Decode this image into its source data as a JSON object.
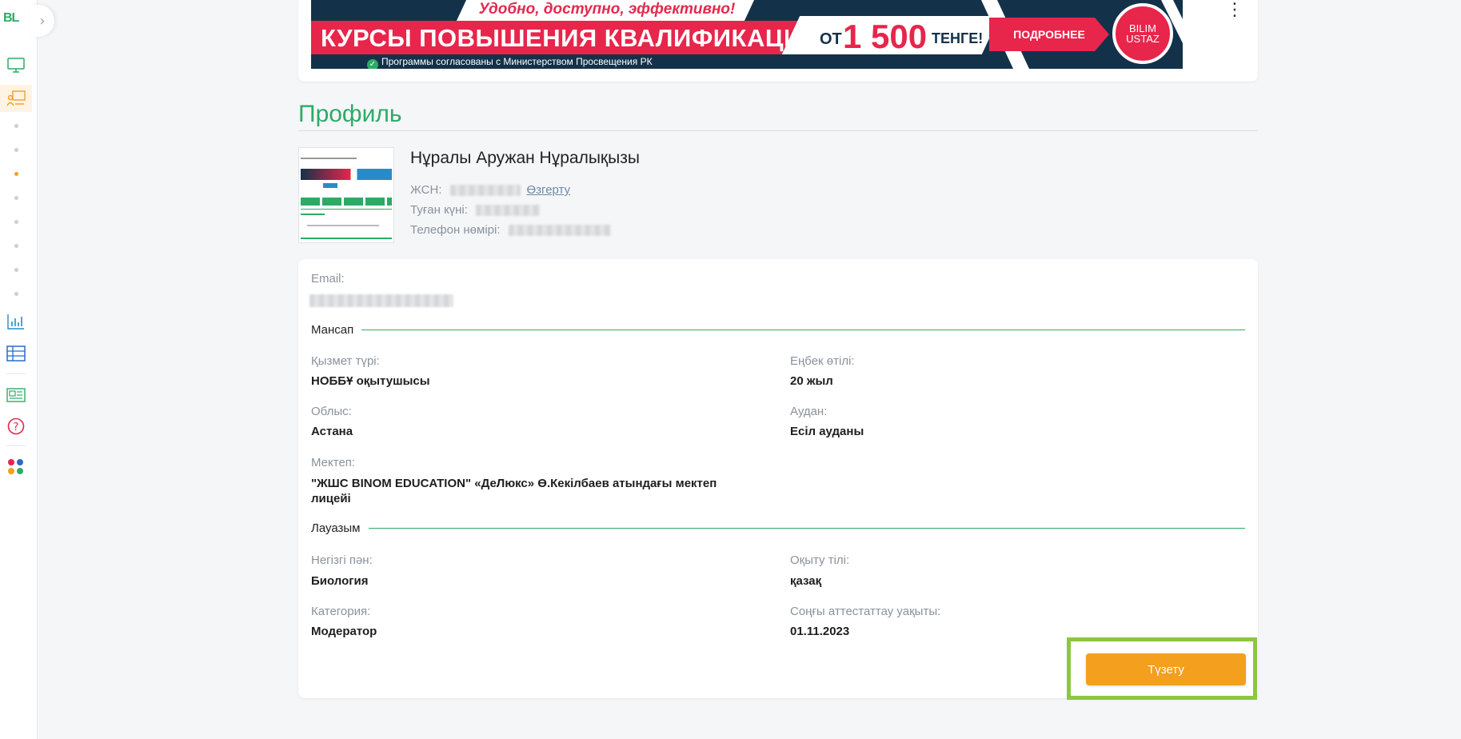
{
  "sidebar": {
    "logo": "BL",
    "collapse_icon": "chevron-right-icon",
    "icons": [
      "monitor-icon",
      "classroom-icon",
      "chart-icon",
      "table-icon",
      "news-icon",
      "help-icon",
      "apps-icon"
    ],
    "accent": "#f49f1e",
    "sub_items": 8,
    "active_sub_index": 2
  },
  "banner": {
    "top_line": "Удобно, доступно, эффективно!",
    "headline": "КУРСЫ ПОВЫШЕНИЯ КВАЛИФИКАЦИИ",
    "price_prefix": "ОТ",
    "price_value": "1 500",
    "price_currency": "ТЕНГЕ!",
    "button_label": "ПОДРОБНЕЕ",
    "subline": "Программы согласованы с Министерством Просвещения РК",
    "logo_line1": "BILIM",
    "logo_line2": "USTAZ",
    "colors": {
      "navy": "#13324a",
      "red": "#e8254b"
    }
  },
  "profile": {
    "title": "Профиль",
    "full_name": "Нұралы Аружан Нұралықызы",
    "iin_label": "ЖСН:",
    "change_link": "Өзгерту",
    "birth_label": "Туған күні:",
    "phone_label": "Телефон нөмірі:"
  },
  "details": {
    "email_label": "Email:",
    "career_section": "Мансап",
    "service_type_label": "Қызмет түрі:",
    "service_type_value": "НОББҰ оқытушысы",
    "experience_label": "Еңбек өтілі:",
    "experience_value": "20 жыл",
    "region_label": "Облыс:",
    "region_value": "Астана",
    "district_label": "Аудан:",
    "district_value": "Есіл ауданы",
    "school_label": "Мектеп:",
    "school_value_line1": "\"ЖШС BINOM EDUCATION\" «ДеЛюкс» Ө.Кекілбаев атындағы мектеп",
    "school_value_line2": "лицейі",
    "position_section": "Лауазым",
    "subject_label": "Негізгі пән:",
    "subject_value": "Биология",
    "language_label": "Оқыту тілі:",
    "language_value": "қазақ",
    "category_label": "Категория:",
    "category_value": "Модератор",
    "attestation_label": "Соңғы аттестаттау уақыты:",
    "attestation_value": "01.11.2023",
    "edit_button": "Түзету"
  },
  "theme": {
    "green": "#2dab66",
    "orange": "#f49f1e",
    "highlight": "#8dc63f"
  }
}
